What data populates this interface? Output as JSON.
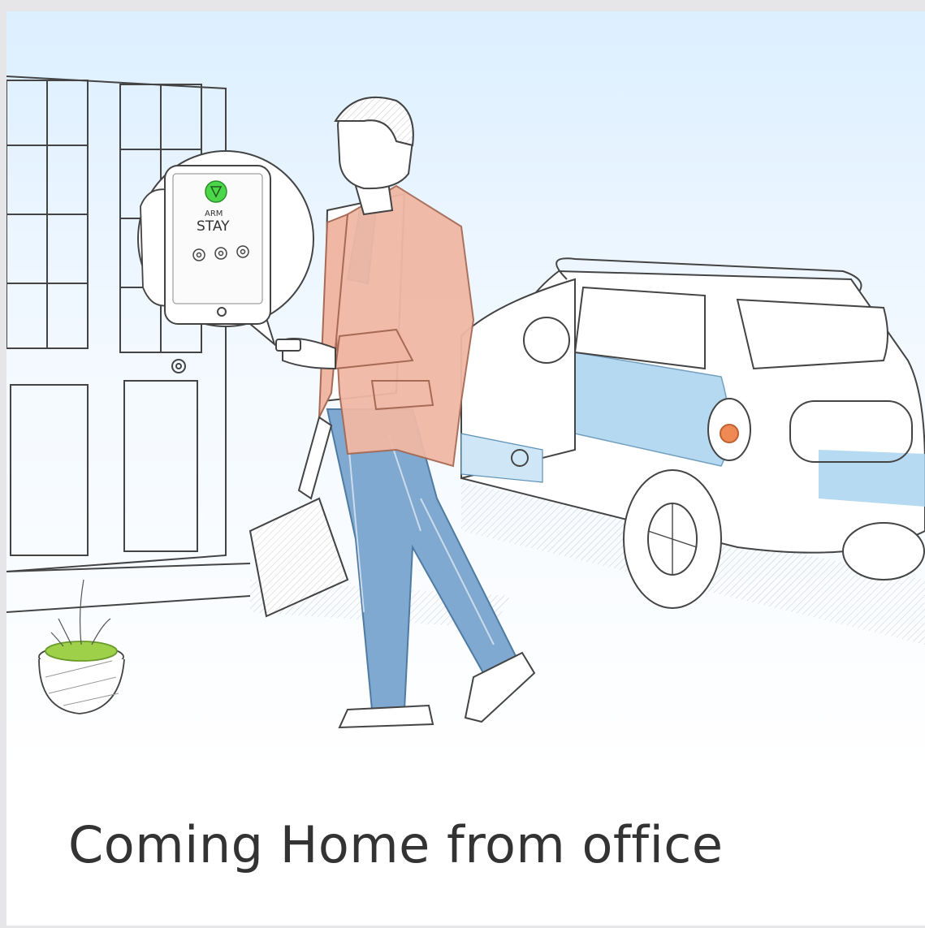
{
  "card": {
    "caption": "Coming Home from office"
  },
  "illustration": {
    "phone_screen": {
      "top_label": "ARM",
      "main_label": "STAY",
      "status_color": "#4cd64a"
    },
    "colors": {
      "sky": "#dcefff",
      "jacket": "#f0b8a4",
      "jeans": "#7fa9d0",
      "car_accent": "#a9d3ef",
      "tail_light": "#f08a55",
      "plant": "#9fd04a"
    }
  }
}
